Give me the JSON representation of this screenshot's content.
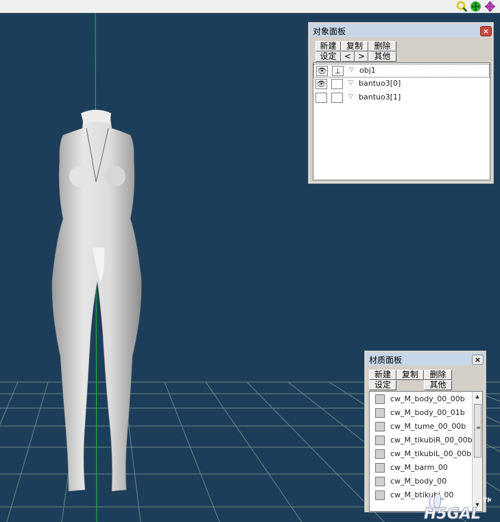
{
  "toolbar": {
    "icons": [
      "zoom-icon",
      "move-icon",
      "rotate-icon"
    ],
    "colors": {
      "zoom": "#d8c200",
      "move": "#2fb52f",
      "rotate": "#b52fb5"
    }
  },
  "viewport": {
    "background": "#1d3e5a",
    "grid_color": "#6c8a88",
    "axis_color": "#1cc43a",
    "model_color": "#d9d9d9"
  },
  "object_panel": {
    "title": "对象面板",
    "buttons": {
      "new": "新建",
      "copy": "复制",
      "delete": "删除",
      "settings": "设定",
      "prev": "<",
      "next": ">",
      "other": "其他"
    },
    "objects": [
      {
        "name": "obj1",
        "visible": true,
        "locked": true,
        "selected": true
      },
      {
        "name": "bantuo3[0]",
        "visible": true,
        "locked": false,
        "selected": false
      },
      {
        "name": "bantuo3[1]",
        "visible": false,
        "locked": false,
        "selected": false
      }
    ]
  },
  "material_panel": {
    "title": "材质面板",
    "buttons": {
      "new": "新建",
      "copy": "复制",
      "delete": "删除",
      "settings": "设定",
      "other": "其他"
    },
    "materials": [
      "cw_M_body_00_00b",
      "cw_M_body_00_01b",
      "cw_M_tume_00_00b",
      "cw_M_tikubiR_00_00b",
      "cw_M_tikubiL_00_00b",
      "cw_M_barm_00",
      "cw_M_body_00",
      "cw_M_btikubi_00"
    ]
  },
  "watermark": {
    "text": "H5GAL",
    "tm": "TM"
  }
}
